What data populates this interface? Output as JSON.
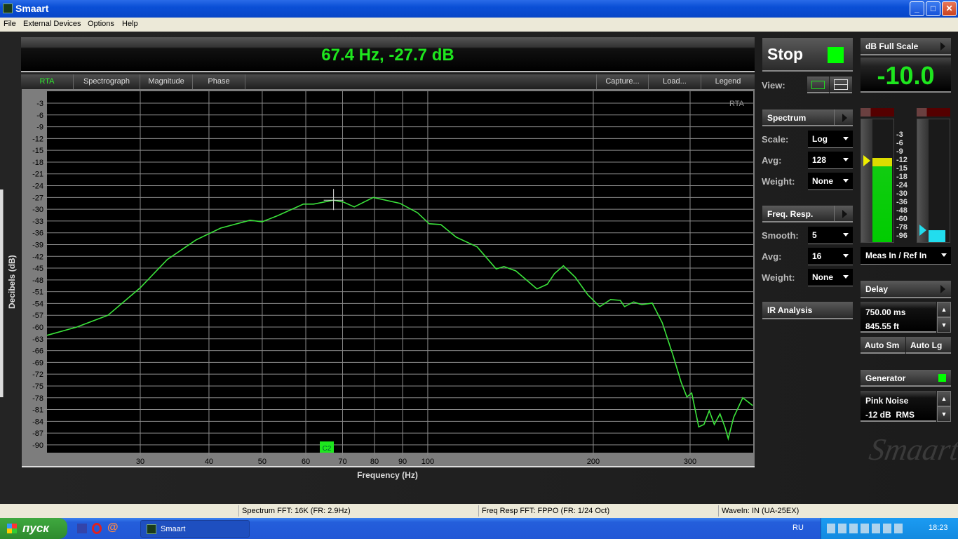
{
  "window": {
    "title": "Smaart",
    "minimize": "_",
    "maximize": "□",
    "close": "✕"
  },
  "menu": [
    "File",
    "External Devices",
    "Options",
    "Help"
  ],
  "readout": "67.4 Hz, -27.7 dB",
  "tabs_left": [
    "RTA",
    "Spectrograph",
    "Magnitude",
    "Phase"
  ],
  "tabs_right": [
    "Capture...",
    "Load...",
    "Legend"
  ],
  "plot": {
    "mode_label": "RTA",
    "cursor_marker": "C2"
  },
  "chart_data": {
    "type": "line",
    "xlabel": "Frequency (Hz)",
    "ylabel": "Decibels (dB)",
    "xscale": "log",
    "xlim": [
      20.3,
      390
    ],
    "ylim": [
      -93,
      0
    ],
    "xticks": [
      30,
      40,
      50,
      60,
      70,
      80,
      90,
      100,
      200,
      300
    ],
    "yticks": [
      -3,
      -6,
      -9,
      -12,
      -15,
      -18,
      -21,
      -24,
      -27,
      -30,
      -33,
      -36,
      -39,
      -42,
      -45,
      -48,
      -51,
      -54,
      -57,
      -60,
      -63,
      -66,
      -69,
      -72,
      -75,
      -78,
      -81,
      -84,
      -87,
      -90
    ],
    "grid": true,
    "line_color": "#3be33b",
    "cursor": {
      "x": 67.4,
      "y": -27.7
    },
    "x": [
      20.3,
      23,
      26.2,
      30,
      33.6,
      37.9,
      42,
      47.5,
      50,
      53.4,
      59.4,
      62,
      67.4,
      70.3,
      73.5,
      79.6,
      89,
      95.8,
      100.6,
      105.6,
      112.6,
      123,
      133.2,
      137.6,
      144.6,
      158,
      165,
      170,
      176.5,
      185.4,
      195.5,
      205.5,
      215,
      224,
      228,
      236.8,
      245,
      256,
      267,
      279,
      289,
      296,
      302,
      311,
      318,
      325,
      332,
      340,
      347,
      352,
      360,
      374,
      390
    ],
    "y": [
      -62.1,
      -60,
      -57,
      -50,
      -42.8,
      -37.8,
      -34.8,
      -32.8,
      -33.2,
      -31.6,
      -28.7,
      -28.7,
      -27.7,
      -28.2,
      -29.4,
      -27,
      -28.5,
      -30.9,
      -33.7,
      -33.9,
      -37.1,
      -39.6,
      -45.2,
      -44.6,
      -45.7,
      -50.3,
      -49.1,
      -46.4,
      -44.4,
      -47.3,
      -51.8,
      -54.8,
      -53,
      -53.2,
      -54.8,
      -53.6,
      -54.3,
      -53.9,
      -58.9,
      -67,
      -74.1,
      -77.8,
      -76.8,
      -85.4,
      -84.8,
      -81.3,
      -84.8,
      -82.1,
      -85.4,
      -88.4,
      -83,
      -78,
      -80
    ]
  },
  "controls": {
    "stop_label": "Stop",
    "view_label": "View:",
    "spectrum": {
      "title": "Spectrum",
      "scale_label": "Scale:",
      "scale": "Log",
      "avg_label": "Avg:",
      "avg": "128",
      "weight_label": "Weight:",
      "weight": "None"
    },
    "freq_resp": {
      "title": "Freq. Resp.",
      "smooth_label": "Smooth:",
      "smooth": "5",
      "avg_label": "Avg:",
      "avg": "16",
      "weight_label": "Weight:",
      "weight": "None"
    },
    "ir_analysis": "IR Analysis",
    "full_scale": {
      "title": "dB Full Scale",
      "value": "-10.0"
    },
    "meter_scale": [
      "-3",
      "-6",
      "-9",
      "-12",
      "-15",
      "-18",
      "-24",
      "-30",
      "-36",
      "-48",
      "-60",
      "-78",
      "-96"
    ],
    "meter_levels": {
      "meas_db": -10,
      "ref_db": -96
    },
    "meter_select": "Meas In / Ref In",
    "delay": {
      "title": "Delay",
      "ms": "750.00 ms",
      "ft": "845.55 ft",
      "auto_sm": "Auto Sm",
      "auto_lg": "Auto Lg"
    },
    "generator": {
      "title": "Generator",
      "signal": "Pink Noise",
      "level": "-12 dB  RMS"
    },
    "logo": "Smaart"
  },
  "status": [
    "Spectrum FFT: 16K (FR: 2.9Hz)",
    "Freq Resp FFT: FPPO (FR: 1/24 Oct)",
    "WaveIn: IN (UA-25EX)"
  ],
  "taskbar": {
    "start": "пуск",
    "task": "Smaart",
    "lang": "RU",
    "clock": "18:23"
  }
}
